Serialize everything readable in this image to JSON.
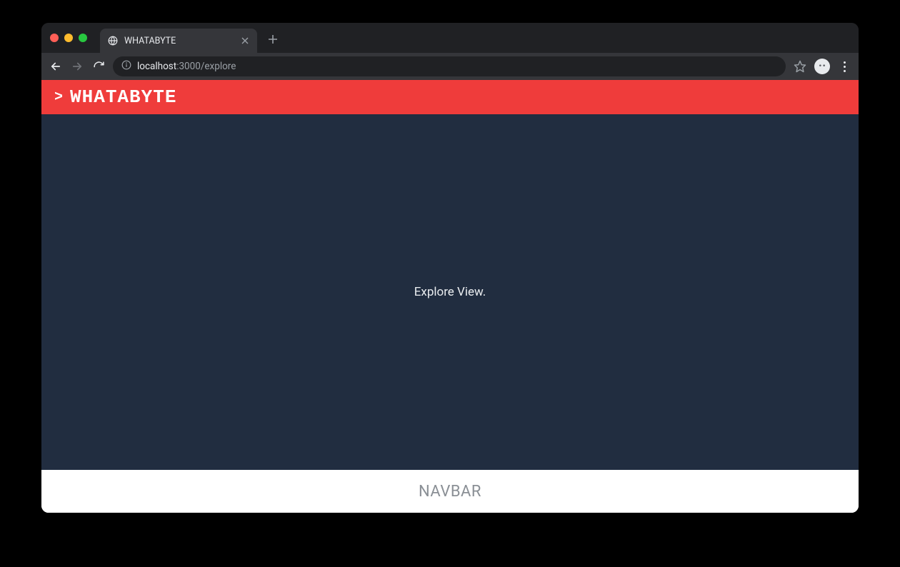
{
  "browser": {
    "tab": {
      "title": "WHATABYTE"
    },
    "address": {
      "host": "localhost",
      "port_path": ":3000/explore"
    }
  },
  "app": {
    "header": {
      "caret": ">",
      "brand": "WHATABYTE"
    },
    "main": {
      "text": "Explore View."
    },
    "navbar": {
      "label": "NAVBAR"
    }
  }
}
